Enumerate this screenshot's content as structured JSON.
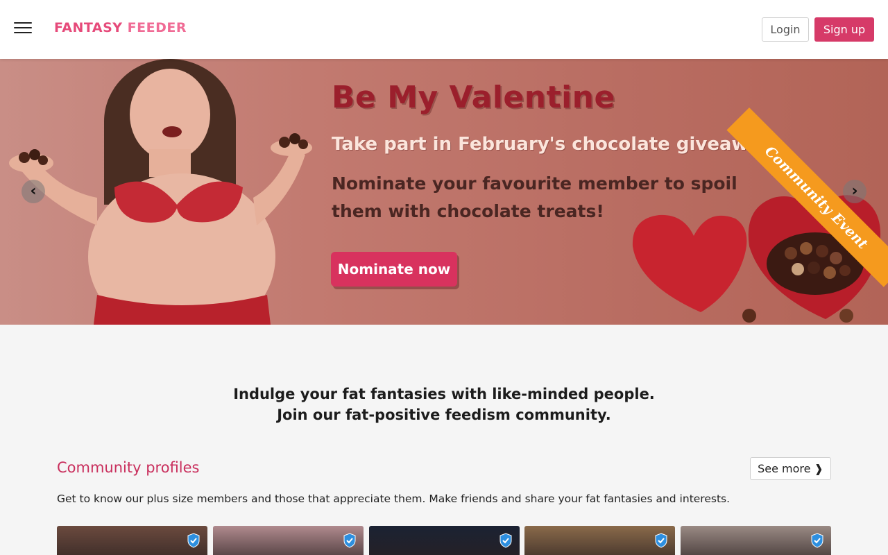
{
  "header": {
    "logo_part1": "FANTASY",
    "logo_part2": "FEEDER",
    "login_label": "Login",
    "signup_label": "Sign up"
  },
  "banner": {
    "title": "Be My Valentine",
    "subtitle": "Take part in February's chocolate giveaway",
    "text": "Nominate your favourite member to spoil them with chocolate treats!",
    "cta_label": "Nominate now",
    "ribbon_label": "Community Event",
    "prev_icon": "chevron-left-icon",
    "next_icon": "chevron-right-icon"
  },
  "tagline": {
    "line1": "Indulge your fat fantasies with like-minded people.",
    "line2": "Join our fat-positive feedism community."
  },
  "community": {
    "title": "Community profiles",
    "see_more_label": "See more ❱",
    "description": "Get to know our plus size members and those that appreciate them. Make friends and share your fat fantasies and interests.",
    "profiles": [
      {
        "verified": true,
        "color": "#6b4a3e"
      },
      {
        "verified": true,
        "color": "#b08a8e"
      },
      {
        "verified": true,
        "color": "#1b2233"
      },
      {
        "verified": true,
        "color": "#8a6a4a"
      },
      {
        "verified": true,
        "color": "#9a8a84"
      }
    ]
  },
  "colors": {
    "brand": "#d63a68",
    "accent_title": "#9b1f2c",
    "ribbon": "#f59a1e"
  }
}
